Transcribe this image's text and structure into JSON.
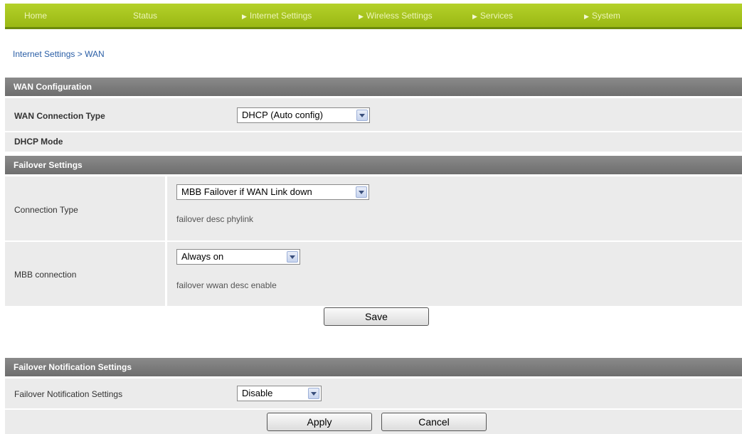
{
  "nav": {
    "home": "Home",
    "status": "Status",
    "internet_settings": "Internet Settings",
    "wireless_settings": "Wireless Settings",
    "services": "Services",
    "system": "System",
    "arrow_glyph": "▶"
  },
  "breadcrumb": "Internet Settings > WAN",
  "wan": {
    "header": "WAN Configuration",
    "connection_type_label": "WAN Connection Type",
    "connection_type_value": "DHCP (Auto config)",
    "dhcp_mode_label": "DHCP Mode"
  },
  "failover": {
    "header": "Failover Settings",
    "connection_type_label": "Connection Type",
    "connection_type_value": "MBB Failover if WAN Link down",
    "connection_type_desc": "failover desc phylink",
    "mbb_label": "MBB connection",
    "mbb_value": "Always on",
    "mbb_desc": "failover wwan desc enable",
    "save_label": "Save"
  },
  "notification": {
    "header": "Failover Notification Settings",
    "label": "Failover Notification Settings",
    "value": "Disable",
    "apply_label": "Apply",
    "cancel_label": "Cancel"
  },
  "colors": {
    "nav_bar": "#a8c51e",
    "section_header": "#7a7a7a",
    "row_bg": "#ebebeb",
    "link": "#2a5ea6"
  }
}
